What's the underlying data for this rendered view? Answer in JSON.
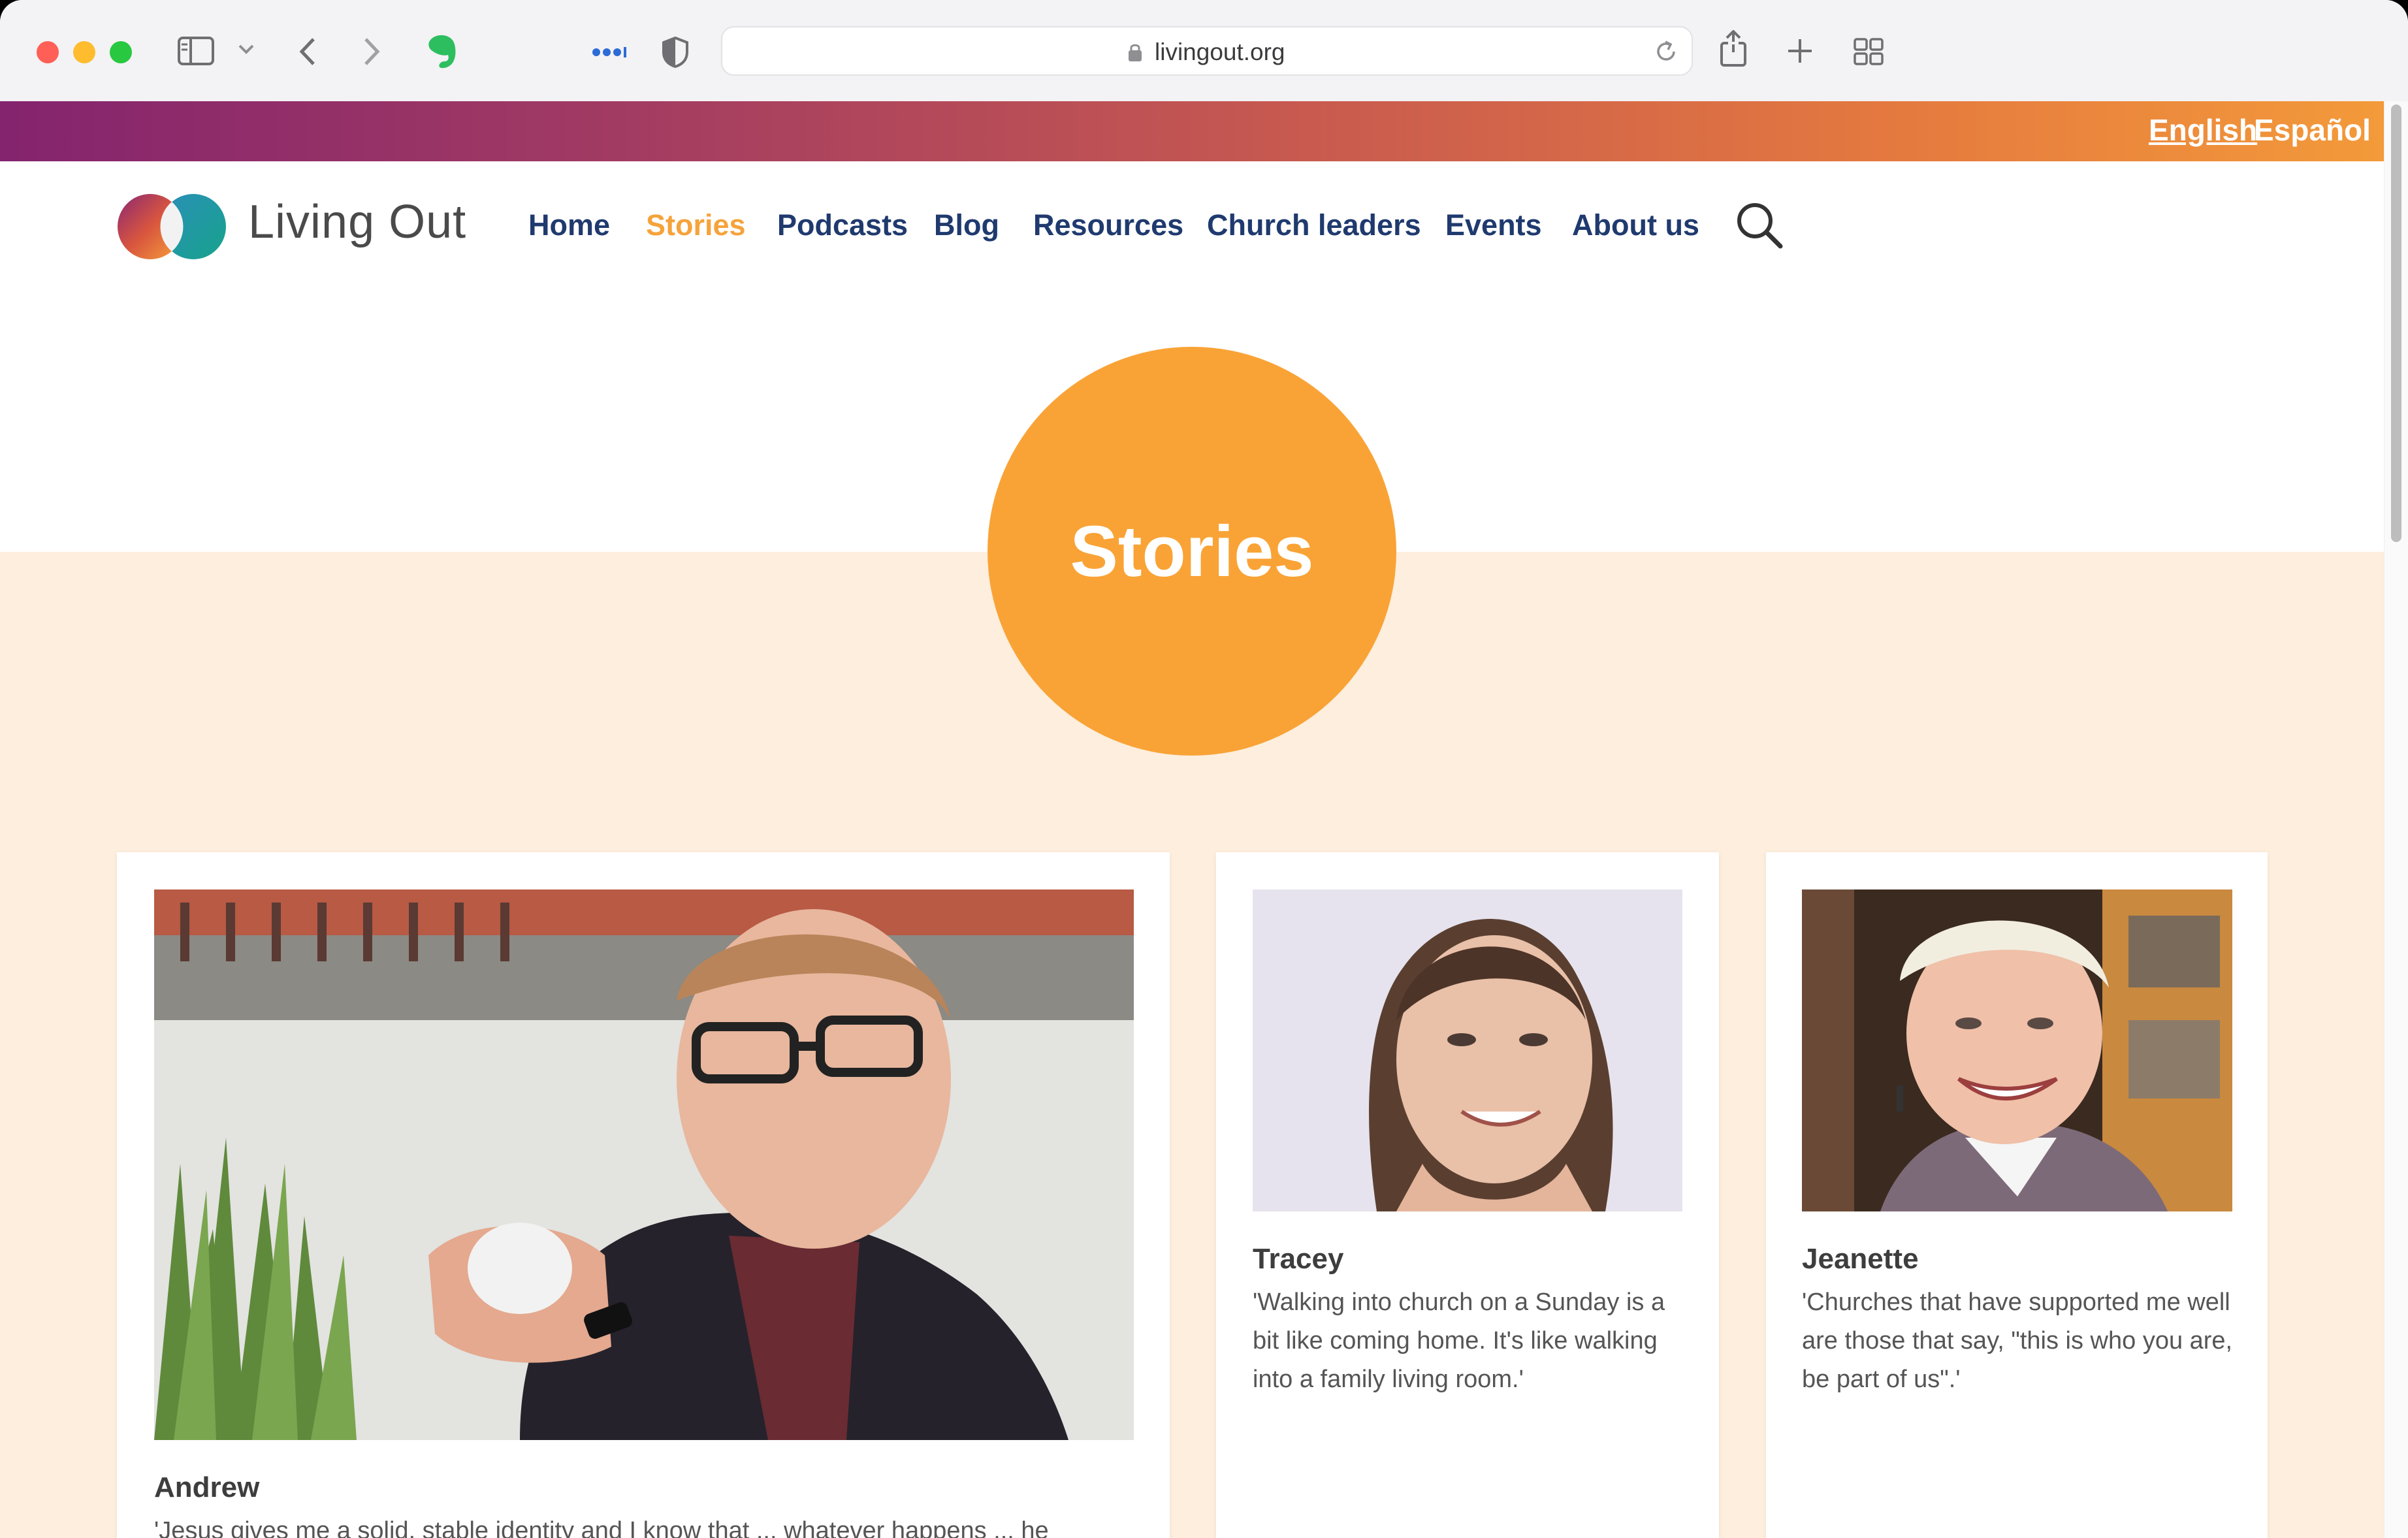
{
  "browser": {
    "url": "livingout.org"
  },
  "languages": {
    "english": "English",
    "espanol": "Español"
  },
  "site": {
    "name": "Living Out"
  },
  "nav": {
    "home": "Home",
    "stories": "Stories",
    "podcasts": "Podcasts",
    "blog": "Blog",
    "resources": "Resources",
    "church_leaders": "Church leaders",
    "events": "Events",
    "about_us": "About us"
  },
  "hero": {
    "title": "Stories"
  },
  "stories": [
    {
      "name": "Andrew",
      "quote": "'Jesus gives me a solid, stable identity and I know that ... whatever happens ... he"
    },
    {
      "name": "Tracey",
      "quote": "'Walking into church on a Sunday is a bit like coming home. It's like walking into a family living room.'"
    },
    {
      "name": "Jeanette",
      "quote": "'Churches that have supported me well are those that say, \"this is who you are, be part of us\".'"
    }
  ],
  "colors": {
    "accent_orange": "#f9a336",
    "nav_blue": "#1f3a6e",
    "peach_background": "#fdeedd"
  }
}
